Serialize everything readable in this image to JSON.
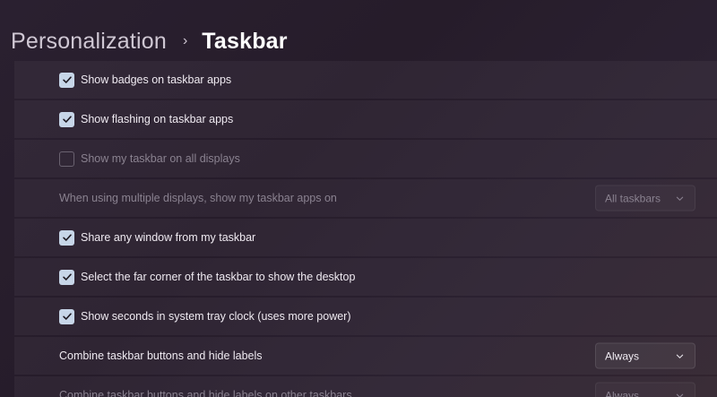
{
  "header": {
    "parent": "Personalization",
    "separator": "›",
    "current": "Taskbar"
  },
  "rows": [
    {
      "label": "Show badges on taskbar apps",
      "checked": true,
      "disabled": false
    },
    {
      "label": "Show flashing on taskbar apps",
      "checked": true,
      "disabled": false
    },
    {
      "label": "Show my taskbar on all displays",
      "checked": false,
      "disabled": true
    },
    {
      "label": "When using multiple displays, show my taskbar apps on",
      "dropdown": "All taskbars",
      "disabled": true
    },
    {
      "label": "Share any window from my taskbar",
      "checked": true,
      "disabled": false
    },
    {
      "label": "Select the far corner of the taskbar to show the desktop",
      "checked": true,
      "disabled": false
    },
    {
      "label": "Show seconds in system tray clock (uses more power)",
      "checked": true,
      "disabled": false
    },
    {
      "label": "Combine taskbar buttons and hide labels",
      "dropdown": "Always",
      "disabled": false
    },
    {
      "label": "Combine taskbar buttons and hide labels on other taskbars",
      "dropdown": "Always",
      "disabled": true
    }
  ],
  "icons": {
    "checkmark": "checkmark-icon",
    "chevron": "chevron-down-icon"
  },
  "colors": {
    "checkbox_fill": "#c7d6e8",
    "checkmark": "#1e1a22"
  }
}
